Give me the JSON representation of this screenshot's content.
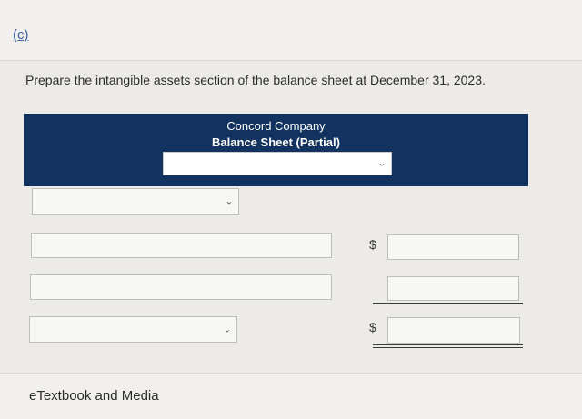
{
  "part_label": "(c)",
  "instructions": "Prepare the intangible assets section of the balance sheet at December 31, 2023.",
  "header": {
    "company": "Concord Company",
    "statement": "Balance Sheet (Partial)",
    "date_select_value": ""
  },
  "rows": [
    {
      "type": "select",
      "value": ""
    },
    {
      "type": "input",
      "value": "",
      "currency_symbol": "$",
      "amount": ""
    },
    {
      "type": "input",
      "value": "",
      "currency_symbol": "",
      "amount": ""
    },
    {
      "type": "select",
      "value": "",
      "currency_symbol": "$",
      "amount": ""
    }
  ],
  "footer": {
    "etextbook_label": "eTextbook and Media"
  },
  "icons": {
    "dropdown": "chevron-down-icon"
  }
}
